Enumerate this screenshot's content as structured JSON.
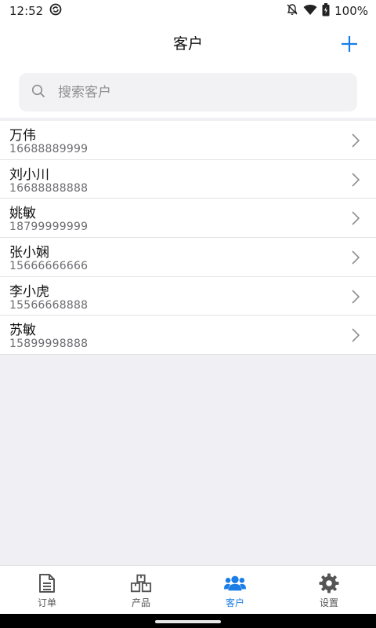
{
  "status_bar": {
    "time": "12:52",
    "battery": "100%",
    "icons": [
      "sync-icon",
      "bell-off-icon",
      "wifi-icon",
      "battery-icon"
    ]
  },
  "header": {
    "title": "客户",
    "add_icon": "plus-icon"
  },
  "search": {
    "placeholder": "搜索客户",
    "value": ""
  },
  "customers": [
    {
      "name": "万伟",
      "phone": "16688889999"
    },
    {
      "name": "刘小川",
      "phone": "16688888888"
    },
    {
      "name": "姚敏",
      "phone": "18799999999"
    },
    {
      "name": "张小娴",
      "phone": "15666666666"
    },
    {
      "name": "李小虎",
      "phone": "15566668888"
    },
    {
      "name": "苏敏",
      "phone": "15899998888"
    }
  ],
  "tabs": [
    {
      "label": "订单",
      "icon": "document-icon",
      "active": false
    },
    {
      "label": "产品",
      "icon": "boxes-icon",
      "active": false
    },
    {
      "label": "客户",
      "icon": "users-icon",
      "active": true
    },
    {
      "label": "设置",
      "icon": "gear-icon",
      "active": false
    }
  ],
  "colors": {
    "accent": "#1a7ee6",
    "background": "#efeff4",
    "tab_inactive": "#555555"
  }
}
